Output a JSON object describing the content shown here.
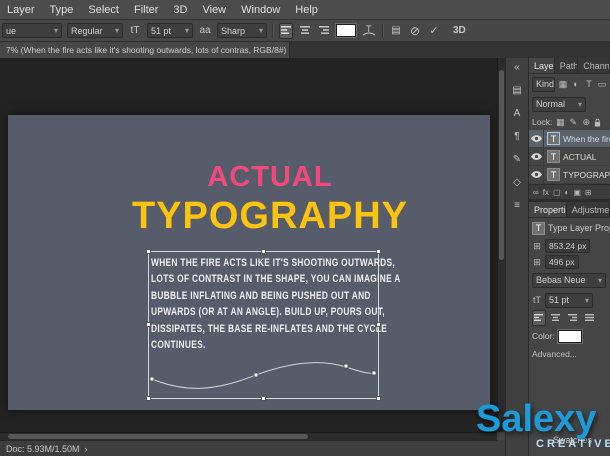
{
  "menu_bar": {
    "items": [
      "Layer",
      "Type",
      "Select",
      "Filter",
      "3D",
      "View",
      "Window",
      "Help"
    ]
  },
  "options_bar": {
    "font_family": "ue",
    "font_style": "Regular",
    "font_size": "51 pt",
    "anti_alias": "Sharp",
    "three_d_label": "3D"
  },
  "document_tab": {
    "title": "7% (When the fire acts like it's shooting outwards, lots of contras, RGB/8#) *"
  },
  "canvas": {
    "background_color": "#575c6a",
    "heading1": {
      "text": "ACTUAL",
      "color": "#f1497c"
    },
    "heading2": {
      "text": "TYPOGRAPHY",
      "color": "#fcc40e"
    },
    "body_color": "#f0f0f2",
    "body_lines": [
      "WHEN THE FIRE ACTS LIKE IT'S SHOOTING OUTWARDS,",
      "LOTS OF CONTRAST IN THE SHAPE, YOU CAN IMAGINE A",
      "BUBBLE INFLATING AND BEING PUSHED OUT AND",
      "UPWARDS (OR AT AN ANGLE). BUILD UP, POURS OUT,",
      "DISSIPATES, THE BASE RE-INFLATES AND THE CYCLE",
      "CONTINUES."
    ]
  },
  "layers_panel": {
    "tabs": [
      "Layers",
      "Paths",
      "Channels"
    ],
    "filter_label": "Kind",
    "blend_mode": "Normal",
    "lock_label": "Lock:",
    "layers": [
      {
        "name": "When the fire",
        "selected": true
      },
      {
        "name": "ACTUAL",
        "selected": false
      },
      {
        "name": "TYPOGRAPHY",
        "selected": false
      }
    ]
  },
  "properties_panel": {
    "tabs": [
      "Properties",
      "Adjustments"
    ],
    "title": "Type Layer Properties",
    "width_value": "853.24 px",
    "height_value": "496 px",
    "font_family": "Bebas Neue",
    "font_size": "51 pt",
    "color_label": "Color:",
    "color_value": "#ffffff",
    "advanced_label": "Advanced..."
  },
  "right_dock": {
    "bottom_tab": "Swatches"
  },
  "status_bar": {
    "doc_info": "Doc: 5.93M/1.50M"
  },
  "watermark": {
    "title": "Salexy",
    "subtitle": "CREATIVE",
    "color": "#1f9ad8"
  },
  "icons": {
    "chevron_down": "▾",
    "close": "×",
    "collapse_right": "«",
    "size": "tT",
    "anti_alias_icon": "aa",
    "cancel": "⊘",
    "commit": "✓",
    "panel_toggle": "▤",
    "flyout": "›",
    "link": "∞",
    "fx": "fx",
    "mask": "▢",
    "adjust": "◐",
    "group": "▣",
    "new_layer": "⊞",
    "filter_pixel": "▦",
    "filter_type": "T",
    "filter_shape": "▭",
    "lock_pixels": "▦",
    "lock_paint": "✎",
    "lock_position": "⊕",
    "transform": "⊞",
    "history": "▤",
    "character": "A",
    "paragraph": "¶",
    "brush": "✎",
    "styles": "◇",
    "lines": "≡"
  }
}
